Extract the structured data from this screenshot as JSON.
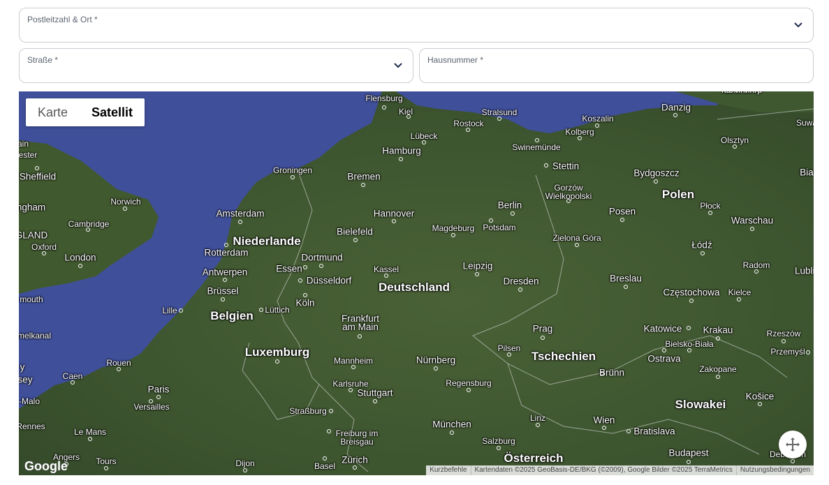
{
  "form": {
    "postal": {
      "label": "Postleitzahl & Ort *",
      "value": ""
    },
    "street": {
      "label": "Straße *",
      "value": ""
    },
    "house": {
      "label": "Hausnummer *",
      "value": ""
    }
  },
  "map": {
    "toggle": {
      "map_label": "Karte",
      "satellite_label": "Satellit",
      "active": "Satellit"
    },
    "labels": {
      "flensburg": "Flensburg",
      "kiel": "Kiel",
      "stralsund": "Stralsund",
      "koszalin": "Koszalin",
      "danzig": "Danzig",
      "rostock": "Rostock",
      "luebeck": "Lübeck",
      "kolberg": "Kolberg",
      "olsztyn": "Olsztyn",
      "suwa": "Suwa",
      "hamburg": "Hamburg",
      "swinemuende": "Swinemünde",
      "stettin": "Stettin",
      "groningen": "Groningen",
      "bremen": "Bremen",
      "bydgoszcz": "Bydgoszcz",
      "bia": "Bia",
      "gorzow": "Gorzów\nWielkopolski",
      "polen": "Polen",
      "ester": "ester",
      "ain": "ain",
      "sheffield": "Sheffield",
      "ingham": "ingham",
      "norwich": "Norwich",
      "amsterdam": "Amsterdam",
      "hannover": "Hannover",
      "berlin": "Berlin",
      "posen": "Posen",
      "plock": "Płock",
      "warschau": "Warschau",
      "cambridge": "Cambridge",
      "gland": "GLAND",
      "niederlande": "Niederlande",
      "bielefeld": "Bielefeld",
      "magdeburg": "Magdeburg",
      "potsdam": "Potsdam",
      "zielona": "Zielona Góra",
      "oxford": "Oxford",
      "lodz": "Łódź",
      "rotterdam": "Rotterdam",
      "london": "London",
      "dortmund": "Dortmund",
      "antwerpen": "Antwerpen",
      "essen": "Essen",
      "kassel": "Kassel",
      "leipzig": "Leipzig",
      "radom": "Radom",
      "lublin": "Lublin",
      "duesseldorf": "Düsseldorf",
      "dresden": "Dresden",
      "breslau": "Breslau",
      "bruessel": "Brüssel",
      "deutschland": "Deutschland",
      "czestochowa": "Częstochowa",
      "kielce": "Kielce",
      "mouth": "mouth",
      "koeln": "Köln",
      "lille": "Lille",
      "luettich": "Lüttich",
      "belgien": "Belgien",
      "frankfurt": "Frankfurt\nam Main",
      "prag": "Prag",
      "katowice": "Katowice",
      "krakau": "Krakau",
      "rzeszow": "Rzeszów",
      "melkanal": "melkanal",
      "pilsen": "Pilsen",
      "bielsko": "Bielsko-Biała",
      "przemysl": "Przemyśl",
      "luxemburg": "Luxemburg",
      "nuernberg": "Nürnberg",
      "tschechien": "Tschechien",
      "ostrava": "Ostrava",
      "rouen": "Rouen",
      "mannheim": "Mannheim",
      "y": "y",
      "sey": "sey",
      "zakopane": "Zakopane",
      "caen": "Caen",
      "bruenn": "Brünn",
      "karlsruhe": "Karlsruhe",
      "regensburg": "Regensburg",
      "paris": "Paris",
      "stuttgart": "Stuttgart",
      "kosice": "Košice",
      "malo": "-Malo",
      "versailles": "Versailles",
      "slowakei": "Slowakei",
      "strassburg": "Straßburg",
      "linz": "Linz",
      "rennes": "Rennes",
      "muenchen": "München",
      "wien": "Wien",
      "bratislava": "Bratislava",
      "lemans": "Le Mans",
      "freiburg": "Freiburg im\nBreisgau",
      "budapest": "Budapest",
      "salzburg": "Salzburg",
      "angers": "Angers",
      "tours": "Tours",
      "zuerich": "Zürich",
      "oesterreich": "Österreich",
      "debrecen": "Debrecen",
      "dijon": "Dijon",
      "basel": "Basel",
      "kaliningrad": "Калинингр"
    },
    "google_logo": "Google",
    "footer": {
      "shortcuts": "Kurzbefehle",
      "attribution": "Kartendaten ©2025 GeoBasis-DE/BKG (©2009), Google Bilder ©2025 TerraMetrics",
      "terms": "Nutzungsbedingungen"
    },
    "fullscreen_icon": "fullscreen-icon",
    "colors": {
      "sea": "#3f4f9a",
      "land": "#3f5a32",
      "border": "#d9d9d9"
    }
  }
}
